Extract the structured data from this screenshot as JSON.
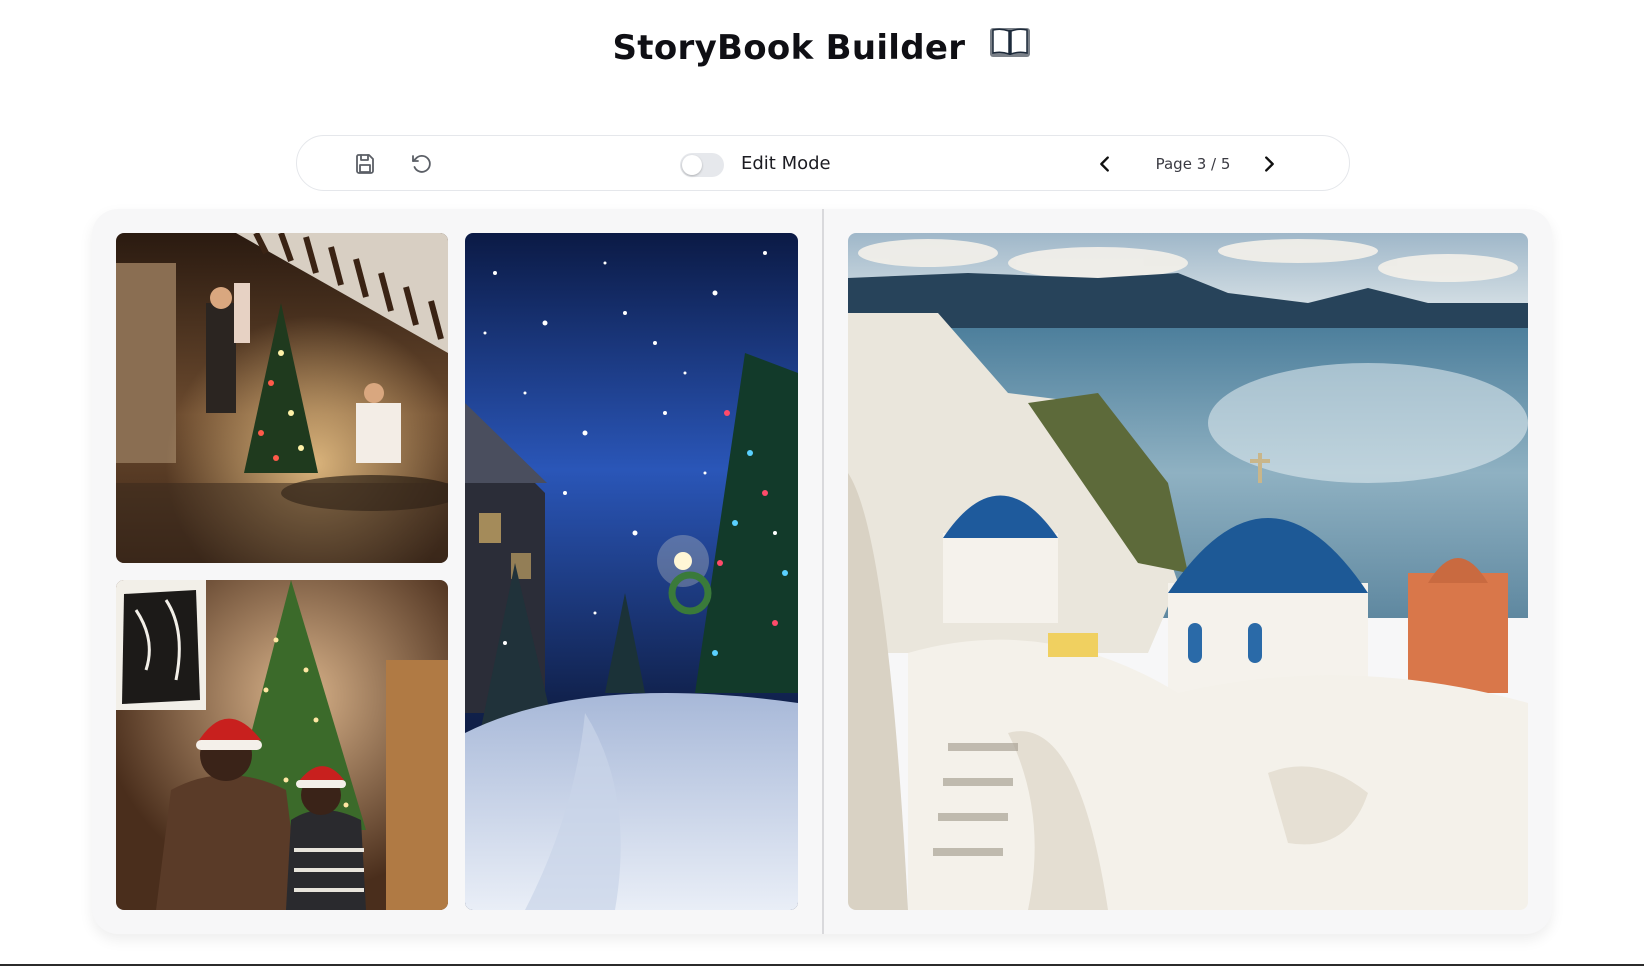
{
  "app": {
    "title": "StoryBook Builder"
  },
  "toolbar": {
    "save_icon": "save-icon",
    "reset_icon": "rotate-ccw-icon",
    "edit_mode_label": "Edit Mode",
    "edit_mode_on": false,
    "prev_icon": "chevron-left-icon",
    "next_icon": "chevron-right-icon",
    "page_indicator": "Page 3 / 5"
  },
  "book": {
    "left_page": {
      "photos": [
        "family-decorating-tree-photo",
        "couple-santa-hats-tree-photo",
        "snowy-night-street-photo"
      ]
    },
    "right_page": {
      "photos": [
        "santorini-blue-domes-photo"
      ]
    }
  },
  "colors": {
    "toggle_track": "#e6e8ec",
    "book_background": "#f7f7f8",
    "spine": "#d9d9dc"
  }
}
